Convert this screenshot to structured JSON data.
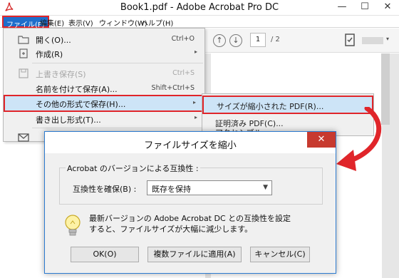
{
  "window": {
    "title": "Book1.pdf - Adobe Acrobat Pro DC",
    "minimize": "—",
    "maximize": "☐",
    "close": "✕"
  },
  "menubar": {
    "items": [
      "ファイル(F)",
      "編集(E)",
      "表示(V)",
      "ウィンドウ(W)",
      "ヘルプ(H)"
    ]
  },
  "toolbar": {
    "page_current": "1",
    "page_total": "/ 2"
  },
  "file_menu": {
    "items": [
      {
        "label": "開く(O)...",
        "shortcut": "Ctrl+O",
        "icon": "folder-icon"
      },
      {
        "label": "作成(R)",
        "arrow": "▸",
        "icon": "create-icon"
      },
      {
        "label": "上書き保存(S)",
        "shortcut": "Ctrl+S",
        "icon": "save-icon"
      },
      {
        "label": "名前を付けて保存(A)...",
        "shortcut": "Shift+Ctrl+S"
      },
      {
        "label": "その他の形式で保存(H)...",
        "arrow": "▸"
      },
      {
        "label": "書き出し形式(T)...",
        "arrow": "▸"
      },
      {
        "label": "",
        "icon": "mail-icon"
      }
    ]
  },
  "submenu": {
    "items": [
      "サイズが縮小された PDF(R)...",
      "証明済み PDF(C)...",
      "アクセシブル..."
    ]
  },
  "dialog": {
    "title": "ファイルサイズを縮小",
    "close": "✕",
    "group_title": "Acrobat のバージョンによる互換性 :",
    "compat_label": "互換性を確保(B) :",
    "compat_value": "既存を保持",
    "info_line1": "最新バージョンの Adobe Acrobat DC との互換性を設定",
    "info_line2": "すると、ファイルサイズが大幅に減少します。",
    "ok": "OK(O)",
    "apply_multiple": "複数ファイルに適用(A)",
    "cancel": "キャンセル(C)"
  }
}
